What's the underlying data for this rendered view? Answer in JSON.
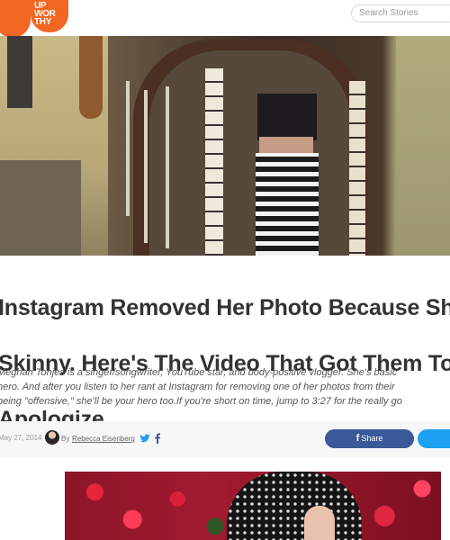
{
  "header": {
    "logo": {
      "line1": "UP",
      "line2": "WOR",
      "line3": "THY",
      "brand_color": "#f26722"
    },
    "search": {
      "placeholder": "Search Stories",
      "icon": "search-icon"
    }
  },
  "article": {
    "headline_lines": [
      "Instagram Removed Her Photo Because She",
      "Skinny. Here's The Video That Got Them To",
      "Apologize."
    ],
    "dek_lines": [
      "Meghan Tonjes is a singer/songwriter, YouTube star, and body-positive vlogger. She's basic",
      "hero. And after you listen to her rant at Instagram for removing one of her photos from their",
      "being \"offensive,\" she'll be your hero too.If you're short on time, jump to 3:27 for the really go"
    ],
    "byline": {
      "date": "May 27, 2014",
      "by_label": "By",
      "author": "Rebecca Eisenberg",
      "icons": [
        "twitter-icon",
        "facebook-icon"
      ]
    },
    "share": {
      "facebook_label": "Share",
      "facebook_icon": "facebook-f-icon",
      "facebook_color": "#3b5998",
      "twitter_color": "#1da1f2"
    }
  }
}
